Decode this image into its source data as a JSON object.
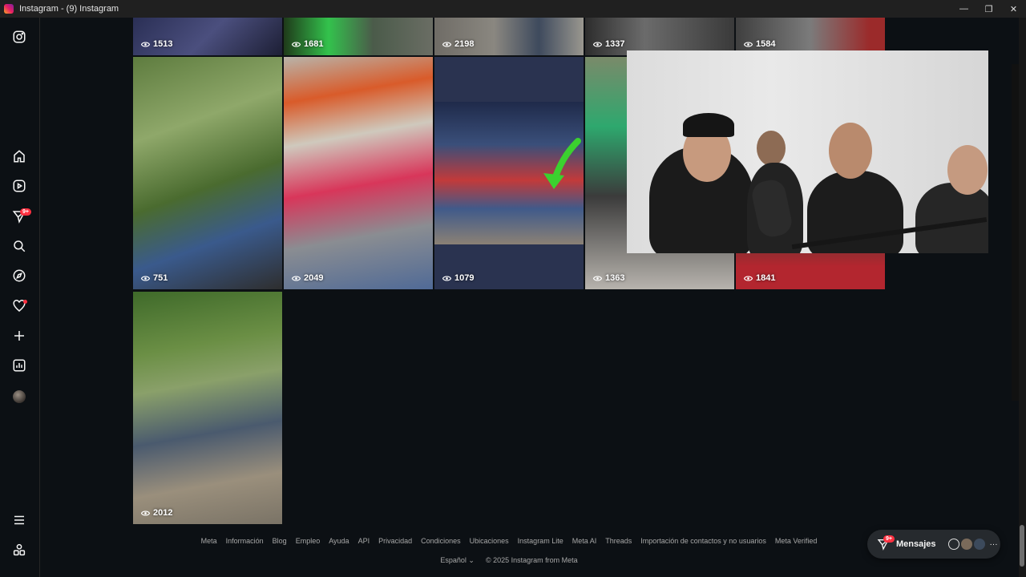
{
  "window": {
    "title": "Instagram - (9) Instagram",
    "minimize": "—",
    "restore": "❐",
    "close": "✕"
  },
  "sidebar": {
    "reels_badge": "9+",
    "icons": [
      "instagram-icon",
      "home-icon",
      "reels-icon",
      "messages-icon",
      "search-icon",
      "explore-icon",
      "notifications-icon",
      "create-icon",
      "dashboard-icon",
      "profile-avatar",
      "more-menu-icon",
      "meta-apps-icon"
    ]
  },
  "grid": {
    "row1": [
      "1513",
      "1681",
      "2198",
      "1337",
      "1584"
    ],
    "row2": [
      "751",
      "2049",
      "1079",
      "1363",
      "1841"
    ],
    "row3": [
      "2012"
    ]
  },
  "footer": {
    "links": [
      "Meta",
      "Información",
      "Blog",
      "Empleo",
      "Ayuda",
      "API",
      "Privacidad",
      "Condiciones",
      "Ubicaciones",
      "Instagram Lite",
      "Meta AI",
      "Threads",
      "Importación de contactos y no usuarios",
      "Meta Verified"
    ],
    "language": "Español",
    "copyright": "© 2025 Instagram from Meta"
  },
  "messages": {
    "label": "Mensajes",
    "badge": "9+",
    "more": "···"
  },
  "colors": {
    "accent_badge": "#ff3040",
    "background": "#0c1014"
  }
}
